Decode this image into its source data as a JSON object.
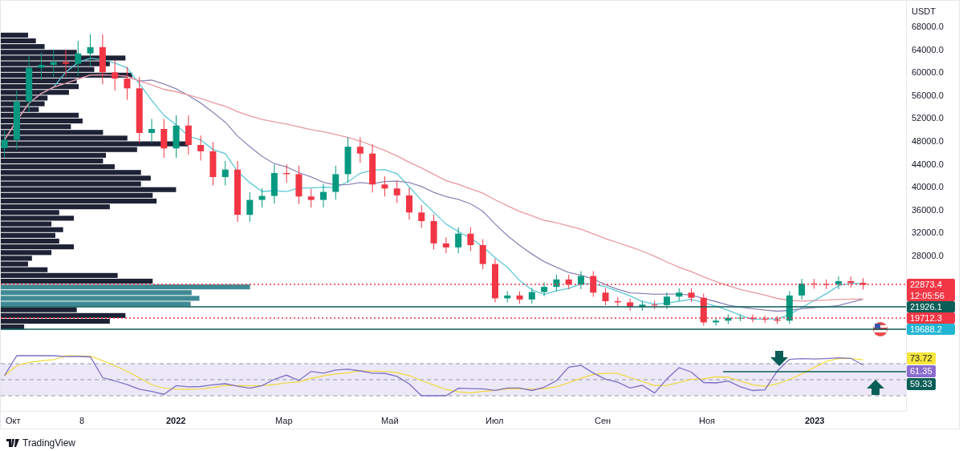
{
  "price_axis": {
    "currency": "USDT",
    "labels": [
      "68000.0",
      "64000.0",
      "60000.0",
      "56000.0",
      "52000.0",
      "48000.0",
      "44000.0",
      "40000.0",
      "36000.0",
      "32000.0",
      "28000.0"
    ]
  },
  "time_axis": [
    {
      "label": "Окт",
      "major": false
    },
    {
      "label": "8",
      "major": false
    },
    {
      "label": "2022",
      "major": true
    },
    {
      "label": "Мар",
      "major": false
    },
    {
      "label": "Май",
      "major": false
    },
    {
      "label": "Июл",
      "major": false
    },
    {
      "label": "Сен",
      "major": false
    },
    {
      "label": "Ноя",
      "major": false
    },
    {
      "label": "2023",
      "major": true
    }
  ],
  "price_labels": [
    {
      "text": "22873.4",
      "subtext": "12:05:56",
      "color": "#f23645",
      "dotted": true
    },
    {
      "text": "21926.1",
      "color": "#0b5e57",
      "dotted": false
    },
    {
      "text": "19712.3",
      "color": "#f23645",
      "dotted": true
    },
    {
      "text": "19688.2",
      "color": "#22b5d3",
      "dotted": false
    }
  ],
  "rsi_labels": [
    {
      "text": "73.72",
      "color": "#f7e63b"
    },
    {
      "text": "61.35",
      "color": "#8b6cd0"
    },
    {
      "text": "59.33",
      "color": "#0b5e57"
    }
  ],
  "branding": {
    "name": "TradingView"
  }
}
